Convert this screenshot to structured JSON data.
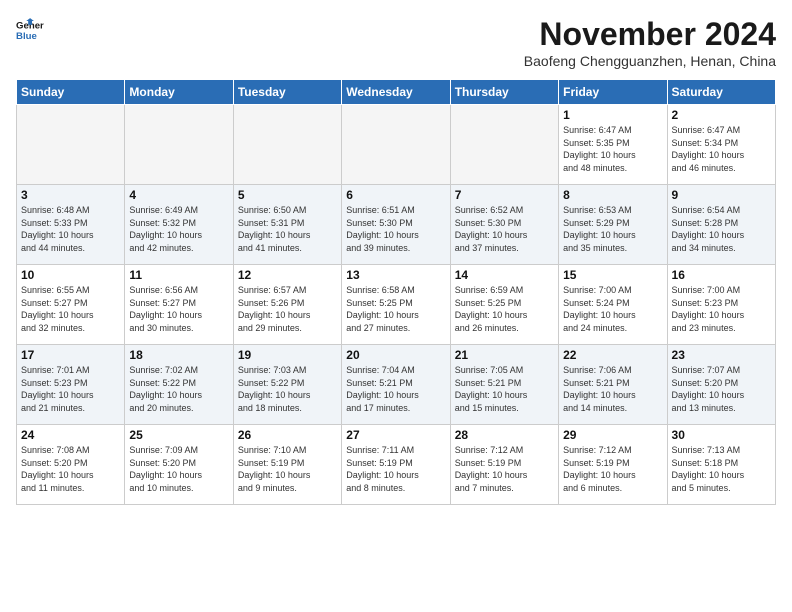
{
  "header": {
    "logo_line1": "General",
    "logo_line2": "Blue",
    "month_title": "November 2024",
    "location": "Baofeng Chengguanzhen, Henan, China"
  },
  "days_of_week": [
    "Sunday",
    "Monday",
    "Tuesday",
    "Wednesday",
    "Thursday",
    "Friday",
    "Saturday"
  ],
  "weeks": [
    [
      {
        "day": "",
        "info": "",
        "empty": true
      },
      {
        "day": "",
        "info": "",
        "empty": true
      },
      {
        "day": "",
        "info": "",
        "empty": true
      },
      {
        "day": "",
        "info": "",
        "empty": true
      },
      {
        "day": "",
        "info": "",
        "empty": true
      },
      {
        "day": "1",
        "info": "Sunrise: 6:47 AM\nSunset: 5:35 PM\nDaylight: 10 hours\nand 48 minutes."
      },
      {
        "day": "2",
        "info": "Sunrise: 6:47 AM\nSunset: 5:34 PM\nDaylight: 10 hours\nand 46 minutes."
      }
    ],
    [
      {
        "day": "3",
        "info": "Sunrise: 6:48 AM\nSunset: 5:33 PM\nDaylight: 10 hours\nand 44 minutes."
      },
      {
        "day": "4",
        "info": "Sunrise: 6:49 AM\nSunset: 5:32 PM\nDaylight: 10 hours\nand 42 minutes."
      },
      {
        "day": "5",
        "info": "Sunrise: 6:50 AM\nSunset: 5:31 PM\nDaylight: 10 hours\nand 41 minutes."
      },
      {
        "day": "6",
        "info": "Sunrise: 6:51 AM\nSunset: 5:30 PM\nDaylight: 10 hours\nand 39 minutes."
      },
      {
        "day": "7",
        "info": "Sunrise: 6:52 AM\nSunset: 5:30 PM\nDaylight: 10 hours\nand 37 minutes."
      },
      {
        "day": "8",
        "info": "Sunrise: 6:53 AM\nSunset: 5:29 PM\nDaylight: 10 hours\nand 35 minutes."
      },
      {
        "day": "9",
        "info": "Sunrise: 6:54 AM\nSunset: 5:28 PM\nDaylight: 10 hours\nand 34 minutes."
      }
    ],
    [
      {
        "day": "10",
        "info": "Sunrise: 6:55 AM\nSunset: 5:27 PM\nDaylight: 10 hours\nand 32 minutes."
      },
      {
        "day": "11",
        "info": "Sunrise: 6:56 AM\nSunset: 5:27 PM\nDaylight: 10 hours\nand 30 minutes."
      },
      {
        "day": "12",
        "info": "Sunrise: 6:57 AM\nSunset: 5:26 PM\nDaylight: 10 hours\nand 29 minutes."
      },
      {
        "day": "13",
        "info": "Sunrise: 6:58 AM\nSunset: 5:25 PM\nDaylight: 10 hours\nand 27 minutes."
      },
      {
        "day": "14",
        "info": "Sunrise: 6:59 AM\nSunset: 5:25 PM\nDaylight: 10 hours\nand 26 minutes."
      },
      {
        "day": "15",
        "info": "Sunrise: 7:00 AM\nSunset: 5:24 PM\nDaylight: 10 hours\nand 24 minutes."
      },
      {
        "day": "16",
        "info": "Sunrise: 7:00 AM\nSunset: 5:23 PM\nDaylight: 10 hours\nand 23 minutes."
      }
    ],
    [
      {
        "day": "17",
        "info": "Sunrise: 7:01 AM\nSunset: 5:23 PM\nDaylight: 10 hours\nand 21 minutes."
      },
      {
        "day": "18",
        "info": "Sunrise: 7:02 AM\nSunset: 5:22 PM\nDaylight: 10 hours\nand 20 minutes."
      },
      {
        "day": "19",
        "info": "Sunrise: 7:03 AM\nSunset: 5:22 PM\nDaylight: 10 hours\nand 18 minutes."
      },
      {
        "day": "20",
        "info": "Sunrise: 7:04 AM\nSunset: 5:21 PM\nDaylight: 10 hours\nand 17 minutes."
      },
      {
        "day": "21",
        "info": "Sunrise: 7:05 AM\nSunset: 5:21 PM\nDaylight: 10 hours\nand 15 minutes."
      },
      {
        "day": "22",
        "info": "Sunrise: 7:06 AM\nSunset: 5:21 PM\nDaylight: 10 hours\nand 14 minutes."
      },
      {
        "day": "23",
        "info": "Sunrise: 7:07 AM\nSunset: 5:20 PM\nDaylight: 10 hours\nand 13 minutes."
      }
    ],
    [
      {
        "day": "24",
        "info": "Sunrise: 7:08 AM\nSunset: 5:20 PM\nDaylight: 10 hours\nand 11 minutes."
      },
      {
        "day": "25",
        "info": "Sunrise: 7:09 AM\nSunset: 5:20 PM\nDaylight: 10 hours\nand 10 minutes."
      },
      {
        "day": "26",
        "info": "Sunrise: 7:10 AM\nSunset: 5:19 PM\nDaylight: 10 hours\nand 9 minutes."
      },
      {
        "day": "27",
        "info": "Sunrise: 7:11 AM\nSunset: 5:19 PM\nDaylight: 10 hours\nand 8 minutes."
      },
      {
        "day": "28",
        "info": "Sunrise: 7:12 AM\nSunset: 5:19 PM\nDaylight: 10 hours\nand 7 minutes."
      },
      {
        "day": "29",
        "info": "Sunrise: 7:12 AM\nSunset: 5:19 PM\nDaylight: 10 hours\nand 6 minutes."
      },
      {
        "day": "30",
        "info": "Sunrise: 7:13 AM\nSunset: 5:18 PM\nDaylight: 10 hours\nand 5 minutes."
      }
    ]
  ]
}
